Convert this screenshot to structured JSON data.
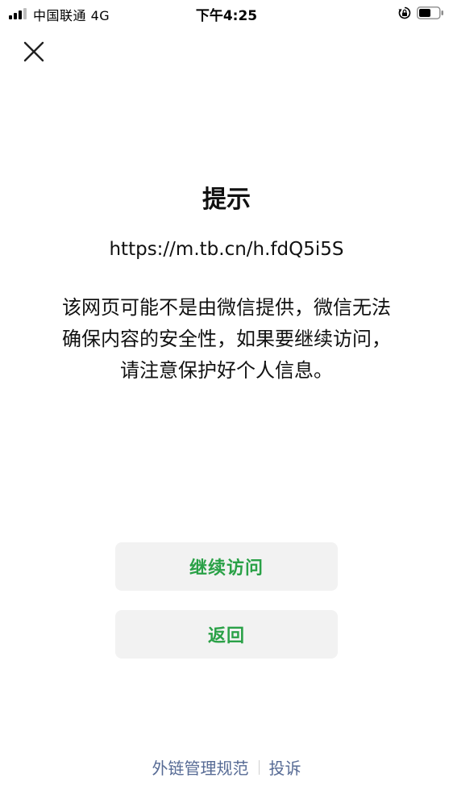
{
  "status_bar": {
    "carrier": "中国联通  4G",
    "time": "下午4:25"
  },
  "dialog": {
    "title": "提示",
    "url": "https://m.tb.cn/h.fdQ5i5S",
    "message_lines": [
      "该网页可能不是由微信提供，微信无法",
      "确保内容的安全性，如果要继续访问，",
      "请注意保护好个人信息。"
    ],
    "continue_label": "继续访问",
    "back_label": "返回"
  },
  "footer": {
    "link_rules": "外链管理规范",
    "link_report": "投诉"
  },
  "colors": {
    "accent_green": "#2aa147",
    "link_blue": "#576b95",
    "button_bg": "#f2f2f2"
  }
}
